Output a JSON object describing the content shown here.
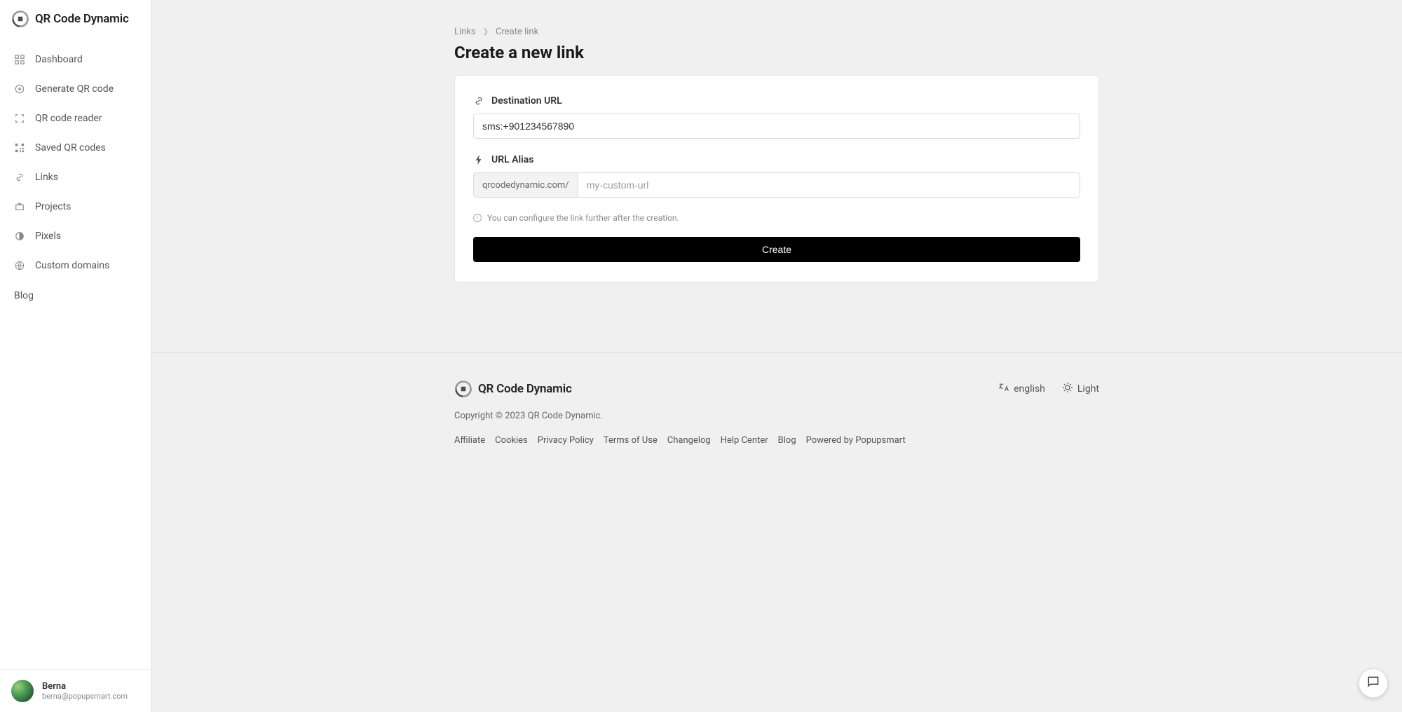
{
  "brand": {
    "name": "QR Code Dynamic"
  },
  "sidebar": {
    "items": [
      {
        "label": "Dashboard"
      },
      {
        "label": "Generate QR code"
      },
      {
        "label": "QR code reader"
      },
      {
        "label": "Saved QR codes"
      },
      {
        "label": "Links"
      },
      {
        "label": "Projects"
      },
      {
        "label": "Pixels"
      },
      {
        "label": "Custom domains"
      },
      {
        "label": "Blog"
      }
    ],
    "user": {
      "name": "Berna",
      "email": "berna@popupsmart.com"
    }
  },
  "breadcrumb": {
    "links": "Links",
    "current": "Create link"
  },
  "page": {
    "title": "Create a new link"
  },
  "form": {
    "destination_label": "Destination URL",
    "destination_value": "sms:+901234567890",
    "alias_label": "URL Alias",
    "alias_prefix": "qrcodedynamic.com/",
    "alias_placeholder": "my-custom-url",
    "alias_value": "",
    "hint": "You can configure the link further after the creation.",
    "submit_label": "Create"
  },
  "footer": {
    "language": "english",
    "theme": "Light",
    "copyright": "Copyright © 2023 QR Code Dynamic.",
    "links": [
      "Affiliate",
      "Cookies",
      "Privacy Policy",
      "Terms of Use",
      "Changelog",
      "Help Center",
      "Blog",
      "Powered by Popupsmart"
    ]
  }
}
